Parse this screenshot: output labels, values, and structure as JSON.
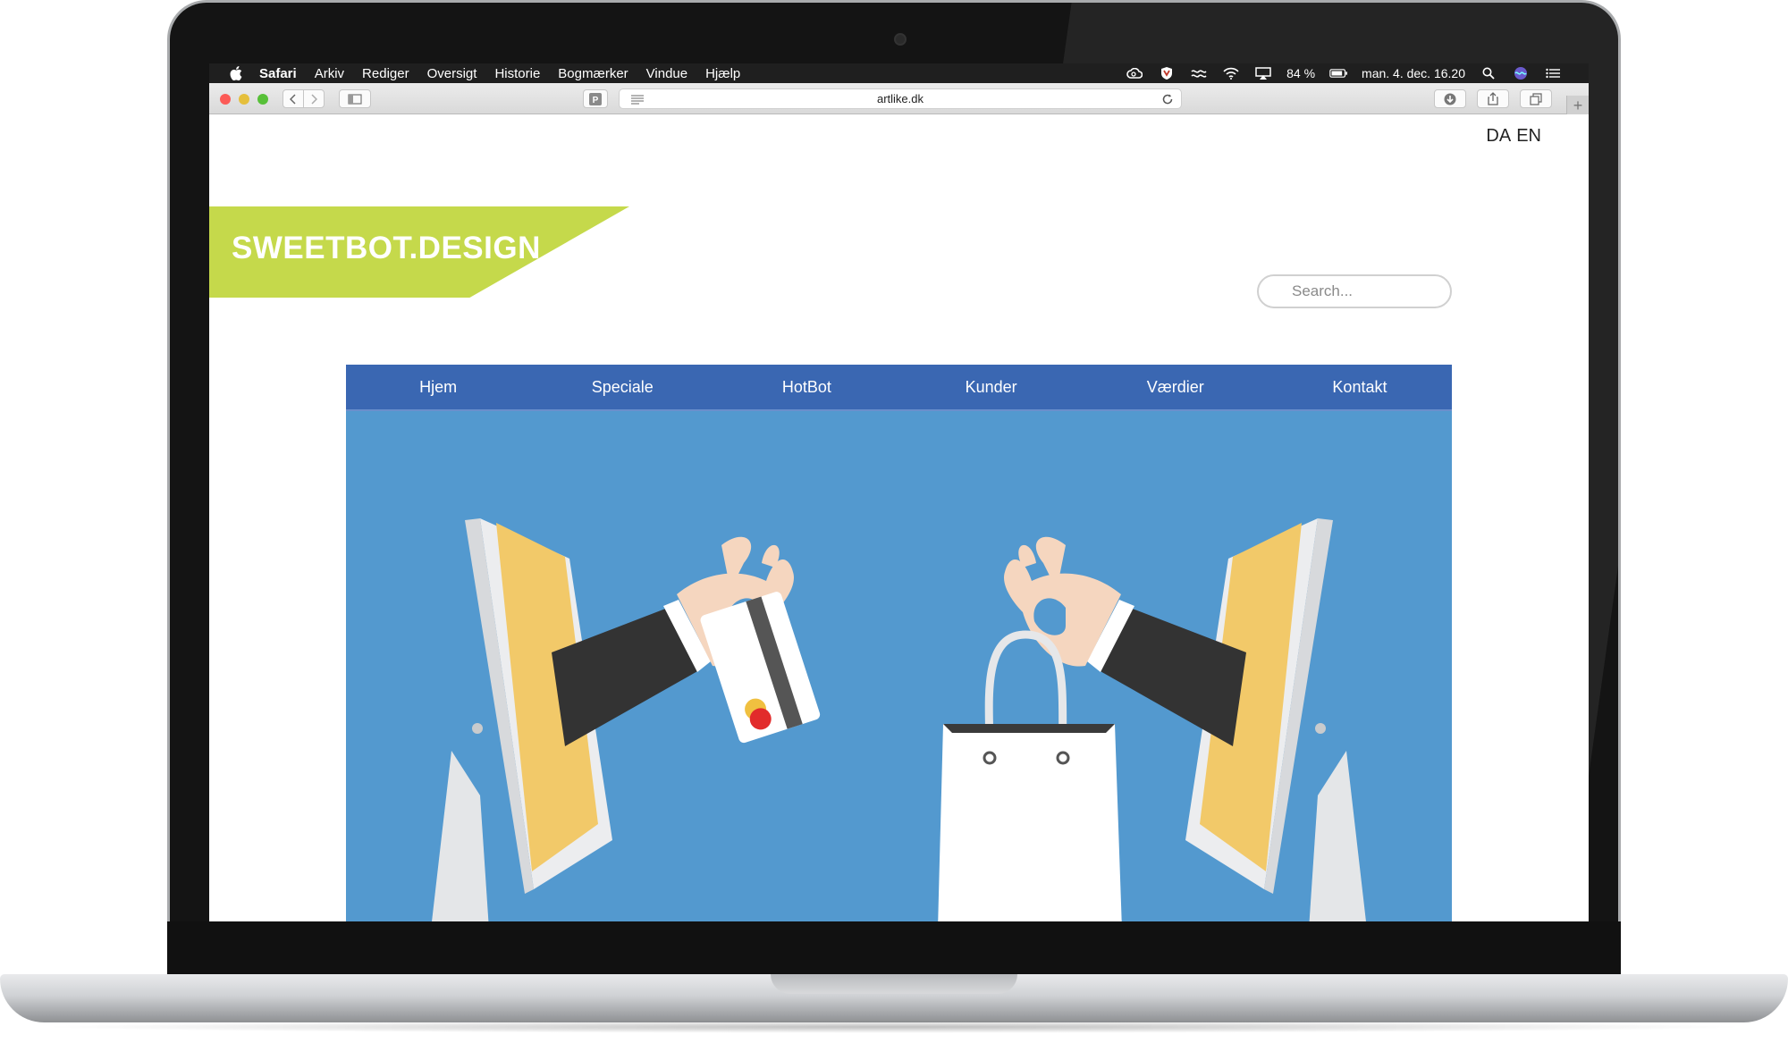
{
  "menubar": {
    "app_name": "Safari",
    "menus": [
      "Arkiv",
      "Rediger",
      "Oversigt",
      "Historie",
      "Bogmærker",
      "Vindue",
      "Hjælp"
    ],
    "battery": "84 %",
    "datetime": "man. 4. dec. 16.20"
  },
  "browser": {
    "url": "artlike.dk",
    "new_tab_label": "+"
  },
  "site": {
    "languages": [
      "DA",
      "EN"
    ],
    "logo": "SWEETBOT.DESIGN",
    "search_placeholder": "Search...",
    "nav": [
      "Hjem",
      "Speciale",
      "HotBot",
      "Kunder",
      "Værdier",
      "Kontakt"
    ]
  },
  "colors": {
    "logo_green": "#c5d94b",
    "nav_blue": "#3a67b2",
    "hero_blue": "#5399cf",
    "screen_yellow": "#f2c969",
    "sleeve": "#333333",
    "skin": "#f5d6bf",
    "card_red": "#e22b2b"
  }
}
